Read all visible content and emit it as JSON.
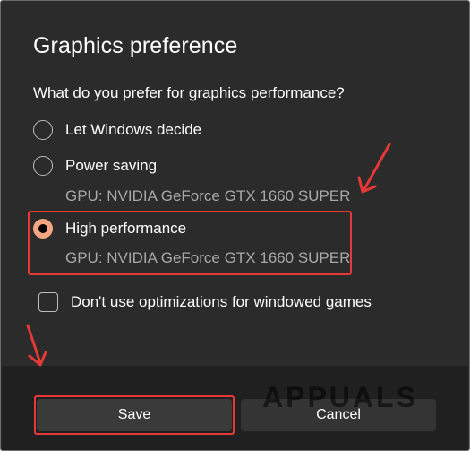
{
  "dialog": {
    "title": "Graphics preference",
    "prompt": "What do you prefer for graphics performance?",
    "options": [
      {
        "label": "Let Windows decide",
        "selected": false
      },
      {
        "label": "Power saving",
        "gpu": "GPU: NVIDIA GeForce GTX 1660 SUPER",
        "selected": false
      },
      {
        "label": "High performance",
        "gpu": "GPU: NVIDIA GeForce GTX 1660 SUPER",
        "selected": true
      }
    ],
    "checkbox": {
      "label": "Don't use optimizations for windowed games",
      "checked": false
    }
  },
  "footer": {
    "save_label": "Save",
    "cancel_label": "Cancel"
  },
  "watermark": {
    "text": "APPUALS"
  },
  "colors": {
    "background": "#2b2b2b",
    "footer_background": "#202020",
    "accent": "#f4a582",
    "annotation": "#e53935",
    "secondary_text": "#a8a8a8"
  }
}
